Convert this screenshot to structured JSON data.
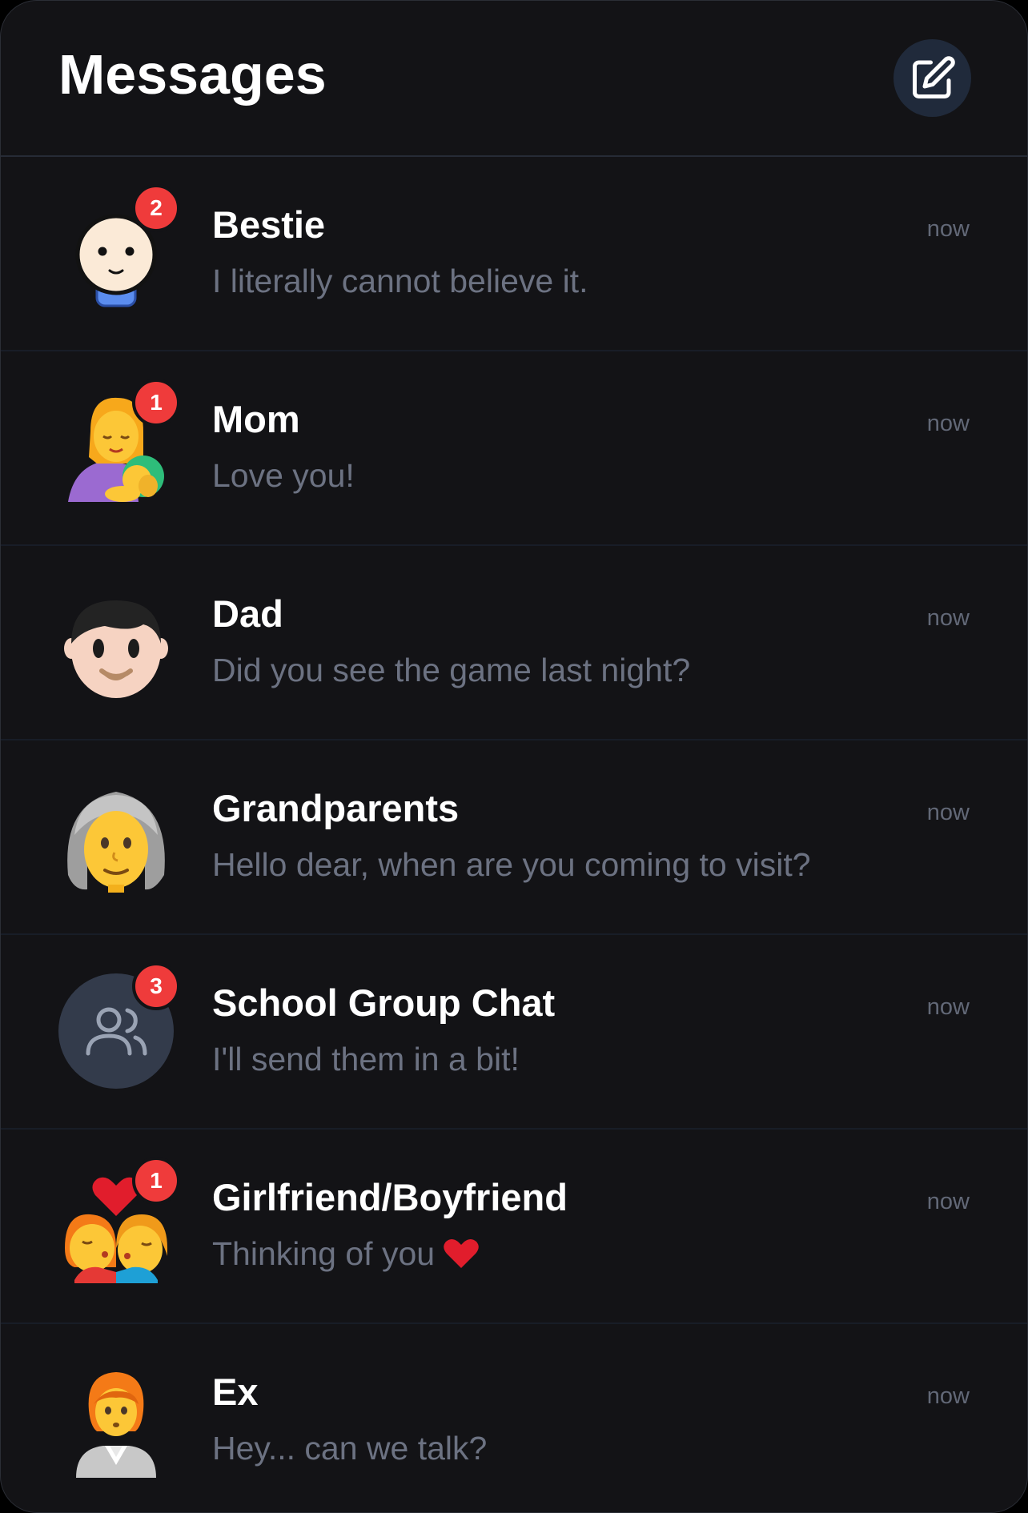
{
  "header": {
    "title": "Messages",
    "compose_icon": "compose-edit-icon"
  },
  "conversations": [
    {
      "name": "Bestie",
      "preview": "I literally cannot believe it.",
      "time": "now",
      "unread": "2",
      "avatar": "smiling-face-avatar"
    },
    {
      "name": "Mom",
      "preview": "Love you!",
      "time": "now",
      "unread": "1",
      "avatar": "woman-feeding-baby-emoji"
    },
    {
      "name": "Dad",
      "preview": "Did you see the game last night?",
      "time": "now",
      "unread": null,
      "avatar": "man-emoji"
    },
    {
      "name": "Grandparents",
      "preview": "Hello dear, when are you coming to visit?",
      "time": "now",
      "unread": null,
      "avatar": "old-woman-emoji"
    },
    {
      "name": "School Group Chat",
      "preview": "I'll send them in a bit!",
      "time": "now",
      "unread": "3",
      "avatar": "group-users-icon"
    },
    {
      "name": "Girlfriend/Boyfriend",
      "preview": "Thinking of you",
      "preview_emoji": "red-heart-icon",
      "time": "now",
      "unread": "1",
      "avatar": "kiss-couple-emoji"
    },
    {
      "name": "Ex",
      "preview": "Hey... can we talk?",
      "time": "now",
      "unread": null,
      "avatar": "person-in-suit-emoji"
    }
  ],
  "colors": {
    "background": "#131316",
    "badge": "#ef3b3b",
    "compose_button": "#202a3b",
    "group_avatar": "#333b4b",
    "preview_text": "#6c7282"
  }
}
